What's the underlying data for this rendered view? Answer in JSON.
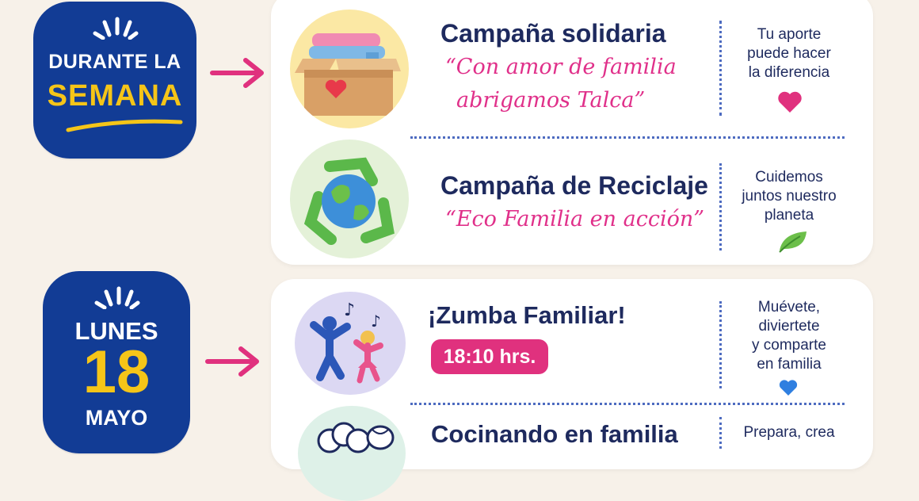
{
  "badge_week": {
    "line1": "DURANTE LA",
    "line2": "SEMANA"
  },
  "badge_day": {
    "weekday": "LUNES",
    "day": "18",
    "month": "MAYO"
  },
  "activities": [
    {
      "title": "Campaña solidaria",
      "quote_line1": "“Con amor de familia",
      "quote_line2": "abrigamos Talca”",
      "side_lines": [
        "Tu aporte",
        "puede hacer",
        "la diferencia"
      ],
      "side_icon": "heart-icon",
      "illustration": "donation-box-icon"
    },
    {
      "title": "Campaña de Reciclaje",
      "quote_line1": "“Eco Familia en acción”",
      "side_lines": [
        "Cuidemos",
        "juntos nuestro",
        "planeta"
      ],
      "side_icon": "leaf-icon",
      "illustration": "recycle-globe-icon"
    },
    {
      "title": "¡Zumba Familiar!",
      "time": "18:10 hrs.",
      "side_lines": [
        "Muévete,",
        "diviertete",
        "y comparte",
        "en familia"
      ],
      "side_icon": "heart-icon",
      "illustration": "dancing-family-icon"
    },
    {
      "title": "Cocinando en familia",
      "side_lines": [
        "Prepara, crea"
      ],
      "illustration": "chef-hat-icon"
    }
  ],
  "colors": {
    "navy": "#123c95",
    "yellow": "#f5c518",
    "pink": "#e0308a",
    "text": "#1e2a5e",
    "background": "#f7f1e9"
  }
}
